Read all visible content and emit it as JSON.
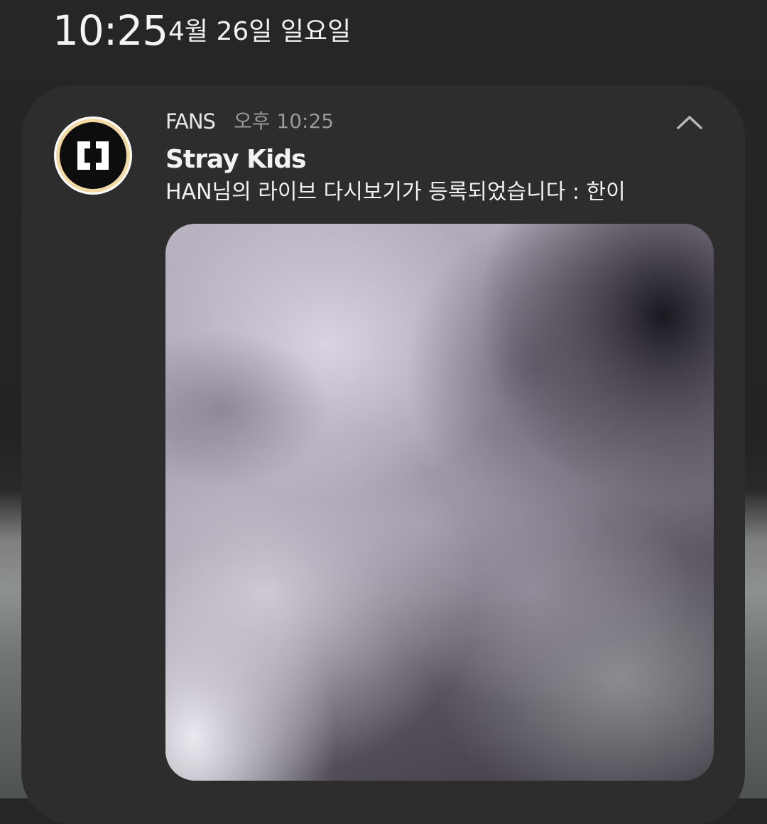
{
  "status_bar": {
    "time": "10:25",
    "date": "4월 26일 일요일"
  },
  "notification": {
    "app_name": "FANS",
    "time": "오후 10:25",
    "title": "Stray Kids",
    "body": "HAN님의 라이브 다시보기가 등록되었습니다 : 한이",
    "app_icon": "fans-logo-icon",
    "collapse_icon": "chevron-up-icon",
    "thumbnail": "blurred-video-thumbnail"
  },
  "colors": {
    "card_background": "#2d2d2d",
    "icon_ring": "#f3d9a4",
    "secondary_text": "#9a9a9a"
  }
}
